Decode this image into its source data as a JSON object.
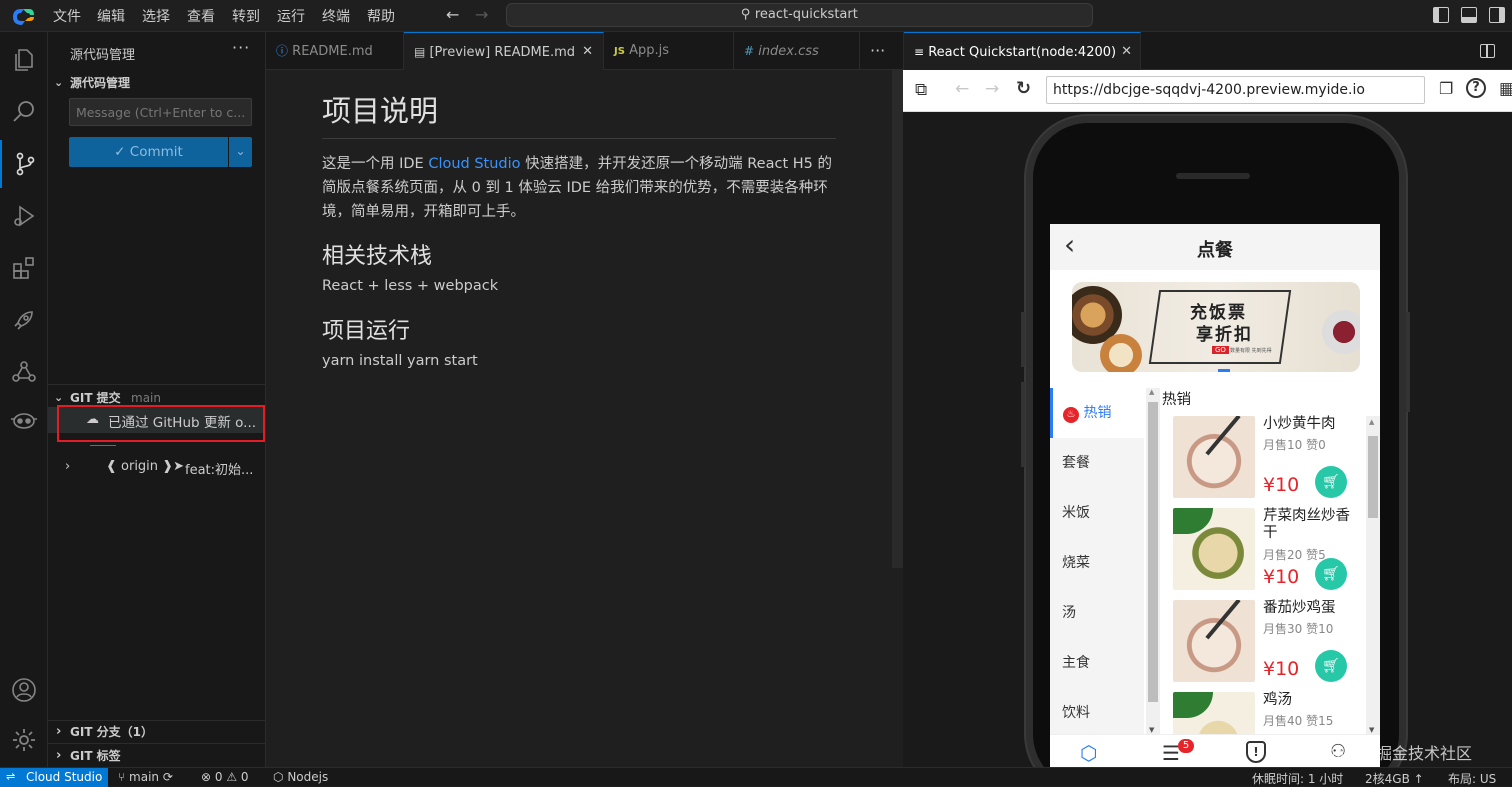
{
  "menubar": {
    "items": [
      "文件",
      "编辑",
      "选择",
      "查看",
      "转到",
      "运行",
      "终端",
      "帮助"
    ],
    "command_center": "react-quickstart"
  },
  "sidebar": {
    "title": "源代码管理",
    "scm_section": "源代码管理",
    "message_placeholder": "Message (Ctrl+Enter to c...",
    "commit_label": "✓ Commit",
    "git_commit_section": "GIT 提交",
    "git_branch_name": "main",
    "commit_item": "已通过 GitHub 更新 o...",
    "origin_item_ref": "❰ origin ❱➤",
    "origin_item_msg": "feat:初始...",
    "git_branches_section": "GIT 分支（1）",
    "git_tags_section": "GIT 标签"
  },
  "tabs": [
    {
      "label": "README.md",
      "icon": "info-icon"
    },
    {
      "label": "[Preview] README.md",
      "icon": "preview-icon",
      "active": true
    },
    {
      "label": "App.js",
      "icon": "js-icon"
    },
    {
      "label": "index.css",
      "icon": "hash-icon"
    }
  ],
  "markdown": {
    "h1": "项目说明",
    "p1_pre": "这是一个用 IDE ",
    "p1_link": "Cloud Studio",
    "p1_post": " 快速搭建，并开发还原一个移动端 React H5 的简版点餐系统页面，从 0 到 1 体验云 IDE 给我们带来的优势，不需要装各种环境，简单易用，开箱即可上手。",
    "h2_stack": "相关技术栈",
    "stack": "React + less + webpack",
    "h2_run": "项目运行",
    "run": "yarn install yarn start"
  },
  "preview": {
    "tab_title": "React Quickstart(node:4200)",
    "url": "https://dbcjge-sqqdvj-4200.preview.myide.io"
  },
  "app": {
    "title": "点餐",
    "banner_line1": "充饭票",
    "banner_line2": "享折扣",
    "banner_tag": "GO",
    "banner_small": "数量有限 先到先得",
    "section_title": "热销",
    "categories": [
      "热销",
      "套餐",
      "米饭",
      "烧菜",
      "汤",
      "主食",
      "饮料"
    ],
    "foods": [
      {
        "name": "小炒黄牛肉",
        "sales": "月售10 赞0",
        "price": "¥10"
      },
      {
        "name": "芹菜肉丝炒香干",
        "sales": "月售20 赞5",
        "price": "¥10"
      },
      {
        "name": "番茄炒鸡蛋",
        "sales": "月售30 赞10",
        "price": "¥10"
      },
      {
        "name": "鸡汤",
        "sales": "月售40 赞15",
        "price": ""
      }
    ],
    "cart_badge": "5"
  },
  "statusbar": {
    "brand": "Cloud Studio",
    "branch": "main",
    "problems": "⊗ 0 ⚠ 0",
    "runtime": "Nodejs",
    "idle": "休眠时间: 1 小时",
    "spec": "2核4GB ↑",
    "layout": "布局: US"
  },
  "watermark": "@稀土掘金技术社区",
  "colors": {
    "accent": "#0e639c",
    "link": "#3794ff",
    "price": "#e5252a",
    "cart": "#27c8a8",
    "highlight_box": "#e51c23"
  }
}
